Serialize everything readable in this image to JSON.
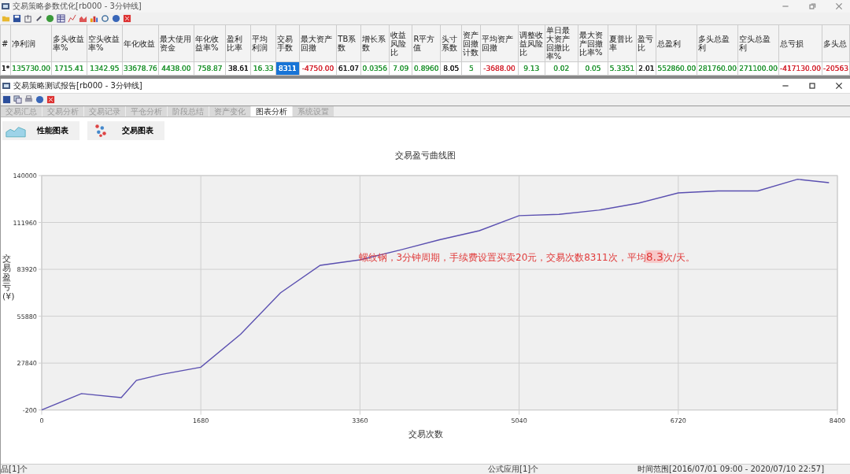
{
  "outer_window": {
    "title": "交易策略参数优化[rb000 - 3分钟线]"
  },
  "results_table": {
    "columns": [
      {
        "header": "#",
        "value": "1*",
        "color": "#222222",
        "selected": false
      },
      {
        "header": "净利润",
        "value": "135730.00",
        "color": "#2e9a3c",
        "selected": false
      },
      {
        "header": "多头收益率%",
        "value": "1715.41",
        "color": "#2e9a3c",
        "selected": false
      },
      {
        "header": "空头收益率%",
        "value": "1342.95",
        "color": "#2e9a3c",
        "selected": false
      },
      {
        "header": "年化收益",
        "value": "33678.76",
        "color": "#2e9a3c",
        "selected": false
      },
      {
        "header": "最大使用资金",
        "value": "4438.00",
        "color": "#2e9a3c",
        "selected": false
      },
      {
        "header": "年化收益率%",
        "value": "758.87",
        "color": "#2e9a3c",
        "selected": false
      },
      {
        "header": "盈利比率",
        "value": "38.61",
        "color": "#222222",
        "selected": false
      },
      {
        "header": "平均利润",
        "value": "16.33",
        "color": "#2e9a3c",
        "selected": false
      },
      {
        "header": "交易手数",
        "value": "8311",
        "color": "#ffffff",
        "selected": true
      },
      {
        "header": "最大资产回撤",
        "value": "-4750.00",
        "color": "#d6303a",
        "selected": false
      },
      {
        "header": "TB系数",
        "value": "61.07",
        "color": "#222222",
        "selected": false
      },
      {
        "header": "增长系数",
        "value": "0.0356",
        "color": "#2e9a3c",
        "selected": false
      },
      {
        "header": "收益风险比",
        "value": "7.09",
        "color": "#2e9a3c",
        "selected": false
      },
      {
        "header": "R平方值",
        "value": "0.8960",
        "color": "#2e9a3c",
        "selected": false
      },
      {
        "header": "头寸系数",
        "value": "8.05",
        "color": "#222222",
        "selected": false
      },
      {
        "header": "资产回撤计数",
        "value": "5",
        "color": "#2e9a3c",
        "selected": false
      },
      {
        "header": "平均资产回撤",
        "value": "-3688.00",
        "color": "#d6303a",
        "selected": false
      },
      {
        "header": "调整收益风险比",
        "value": "9.13",
        "color": "#2e9a3c",
        "selected": false
      },
      {
        "header": "单日最大资产回撤比率%",
        "value": "0.02",
        "color": "#2e9a3c",
        "selected": false
      },
      {
        "header": "最大资产回撤比率%",
        "value": "0.05",
        "color": "#2e9a3c",
        "selected": false
      },
      {
        "header": "夏普比率",
        "value": "5.3351",
        "color": "#2e9a3c",
        "selected": false
      },
      {
        "header": "盈亏比",
        "value": "2.01",
        "color": "#222222",
        "selected": false
      },
      {
        "header": "总盈利",
        "value": "552860.00",
        "color": "#2e9a3c",
        "selected": false
      },
      {
        "header": "多头总盈利",
        "value": "281760.00",
        "color": "#2e9a3c",
        "selected": false
      },
      {
        "header": "空头总盈利",
        "value": "271100.00",
        "color": "#2e9a3c",
        "selected": false
      },
      {
        "header": "总亏损",
        "value": "-417130.00",
        "color": "#d6303a",
        "selected": false
      },
      {
        "header": "多头总",
        "value": "-20563",
        "color": "#d6303a",
        "selected": false
      }
    ]
  },
  "report_window": {
    "title": "交易策略测试报告[rb000 - 3分钟线]"
  },
  "tabs": [
    {
      "label": "交易汇总",
      "selected": false
    },
    {
      "label": "交易分析",
      "selected": false
    },
    {
      "label": "交易记录",
      "selected": false
    },
    {
      "label": "平仓分析",
      "selected": false
    },
    {
      "label": "阶段总结",
      "selected": false
    },
    {
      "label": "资产变化",
      "selected": false
    },
    {
      "label": "图表分析",
      "selected": true
    },
    {
      "label": "系统设置",
      "selected": false
    }
  ],
  "chart_buttons": [
    {
      "label": "性能图表",
      "kind": "performance"
    },
    {
      "label": "交易图表",
      "kind": "trades"
    }
  ],
  "chart": {
    "chart_data": {
      "type": "line",
      "title": "交易盈亏曲线图",
      "xlabel": "交易次数",
      "ylabel": "交易盈亏(¥)",
      "x": [
        0,
        420,
        840,
        1000,
        1260,
        1680,
        2100,
        2520,
        2940,
        3360,
        3780,
        4200,
        4620,
        5040,
        5460,
        5880,
        6300,
        6720,
        7140,
        7560,
        7980,
        8311
      ],
      "grid": true,
      "series": [
        {
          "color": "#5a4fb0",
          "values": [
            -200,
            9600,
            7200,
            17500,
            21000,
            25400,
            45100,
            69800,
            86300,
            89600,
            95400,
            101600,
            107000,
            116000,
            116800,
            119300,
            123500,
            129600,
            130800,
            130800,
            137800,
            135700
          ]
        }
      ],
      "xlim": [
        0,
        8400
      ],
      "ylim": [
        -200,
        140000
      ],
      "xticks": [
        0,
        1680,
        3360,
        5040,
        6720,
        8400
      ],
      "yticks": [
        -200,
        27840,
        55880,
        83920,
        111960,
        140000
      ],
      "annotations": [
        "螺纹钢，3分钟周期，手续费设置买卖20元，交易次数8311次，平均**8.3**次/天。"
      ]
    }
  },
  "status_bar": {
    "items": [
      "品[1]个",
      "公式应用[1]个",
      "时间范围[2016/07/01 09:00 - 2020/07/10 22:57]"
    ]
  }
}
